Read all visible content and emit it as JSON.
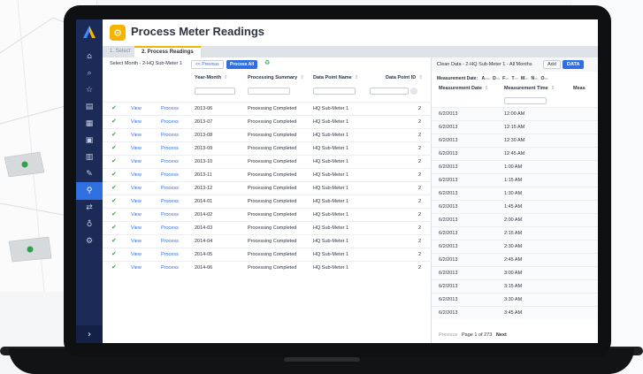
{
  "app": {
    "title": "Process Meter Readings",
    "title_icon": "process-icon"
  },
  "sidebar": {
    "items": [
      {
        "icon": "home-icon",
        "glyph": "⌂"
      },
      {
        "icon": "search-icon",
        "glyph": "⌕"
      },
      {
        "icon": "star-icon",
        "glyph": "☆"
      },
      {
        "icon": "buildings-icon",
        "glyph": "▤"
      },
      {
        "icon": "chart-icon",
        "glyph": "▦"
      },
      {
        "icon": "document-icon",
        "glyph": "▣"
      },
      {
        "icon": "clipboard-icon",
        "glyph": "▥"
      },
      {
        "icon": "wrench-icon",
        "glyph": "✎"
      },
      {
        "icon": "meter-icon",
        "glyph": "⚲"
      },
      {
        "icon": "transfer-icon",
        "glyph": "⇄"
      },
      {
        "icon": "lightbulb-icon",
        "glyph": "♁"
      },
      {
        "icon": "settings-icon",
        "glyph": "⚙"
      }
    ],
    "active_index": 8,
    "expand_glyph": "›"
  },
  "tabs": [
    {
      "label": "1. Select",
      "active": false
    },
    {
      "label": "2. Process Readings",
      "active": true
    }
  ],
  "left_panel": {
    "title": "Select Month - 2-HQ Sub-Meter 1",
    "prev_button": "<< Previous",
    "process_all_button": "Process All",
    "refresh_glyph": "♻",
    "columns": {
      "year_month": "Year-Month",
      "summary": "Processing Summary",
      "dp_name": "Data Point Name",
      "dp_id": "Data Point ID"
    },
    "sort_glyph": "⇕",
    "rows": [
      {
        "check": "✔",
        "view": "View",
        "process": "Process",
        "year_month": "2013-06",
        "summary": "Processing Completed",
        "dp_name": "HQ Sub-Meter 1",
        "dp_id": "2"
      },
      {
        "check": "✔",
        "view": "View",
        "process": "Process",
        "year_month": "2013-07",
        "summary": "Processing Completed",
        "dp_name": "HQ Sub-Meter 1",
        "dp_id": "2"
      },
      {
        "check": "✔",
        "view": "View",
        "process": "Process",
        "year_month": "2013-08",
        "summary": "Processing Completed",
        "dp_name": "HQ Sub-Meter 1",
        "dp_id": "2"
      },
      {
        "check": "✔",
        "view": "View",
        "process": "Process",
        "year_month": "2013-09",
        "summary": "Processing Completed",
        "dp_name": "HQ Sub-Meter 1",
        "dp_id": "2"
      },
      {
        "check": "✔",
        "view": "View",
        "process": "Process",
        "year_month": "2013-10",
        "summary": "Processing Completed",
        "dp_name": "HQ Sub-Meter 1",
        "dp_id": "2"
      },
      {
        "check": "✔",
        "view": "View",
        "process": "Process",
        "year_month": "2013-11",
        "summary": "Processing Completed",
        "dp_name": "HQ Sub-Meter 1",
        "dp_id": "2"
      },
      {
        "check": "✔",
        "view": "View",
        "process": "Process",
        "year_month": "2013-12",
        "summary": "Processing Completed",
        "dp_name": "HQ Sub-Meter 1",
        "dp_id": "2"
      },
      {
        "check": "✔",
        "view": "View",
        "process": "Process",
        "year_month": "2014-01",
        "summary": "Processing Completed",
        "dp_name": "HQ Sub-Meter 1",
        "dp_id": "2"
      },
      {
        "check": "✔",
        "view": "View",
        "process": "Process",
        "year_month": "2014-02",
        "summary": "Processing Completed",
        "dp_name": "HQ Sub-Meter 1",
        "dp_id": "2"
      },
      {
        "check": "✔",
        "view": "View",
        "process": "Process",
        "year_month": "2014-03",
        "summary": "Processing Completed",
        "dp_name": "HQ Sub-Meter 1",
        "dp_id": "2"
      },
      {
        "check": "✔",
        "view": "View",
        "process": "Process",
        "year_month": "2014-04",
        "summary": "Processing Completed",
        "dp_name": "HQ Sub-Meter 1",
        "dp_id": "2"
      },
      {
        "check": "✔",
        "view": "View",
        "process": "Process",
        "year_month": "2014-05",
        "summary": "Processing Completed",
        "dp_name": "HQ Sub-Meter 1",
        "dp_id": "2"
      },
      {
        "check": "✔",
        "view": "View",
        "process": "Process",
        "year_month": "2014-06",
        "summary": "Processing Completed",
        "dp_name": "HQ Sub-Meter 1",
        "dp_id": "2"
      }
    ]
  },
  "right_panel": {
    "title": "Clean Data - 2-HQ Sub-Meter 1 - All Months",
    "add_button": "Add",
    "data_button": "DATA",
    "md_label": "Measurement Date:",
    "md_letters": [
      "A",
      "D",
      "F",
      "T",
      "M",
      "N",
      "O"
    ],
    "md_pcts": [
      "99%",
      "0%",
      "0%",
      "0%",
      "0%",
      "0%",
      "0%"
    ],
    "columns": {
      "date": "Measurement Date",
      "time": "Measurement Time",
      "more": "Meas"
    },
    "sort_glyph": "⇕",
    "rows": [
      {
        "date": "6/2/2013",
        "time": "12:00 AM"
      },
      {
        "date": "6/2/2013",
        "time": "12:15 AM"
      },
      {
        "date": "6/2/2013",
        "time": "12:30 AM"
      },
      {
        "date": "6/2/2013",
        "time": "12:45 AM"
      },
      {
        "date": "6/2/2013",
        "time": "1:00 AM"
      },
      {
        "date": "6/2/2013",
        "time": "1:15 AM"
      },
      {
        "date": "6/2/2013",
        "time": "1:30 AM"
      },
      {
        "date": "6/2/2013",
        "time": "1:45 AM"
      },
      {
        "date": "6/2/2013",
        "time": "2:00 AM"
      },
      {
        "date": "6/2/2013",
        "time": "2:15 AM"
      },
      {
        "date": "6/2/2013",
        "time": "2:30 AM"
      },
      {
        "date": "6/2/2013",
        "time": "2:45 AM"
      },
      {
        "date": "6/2/2013",
        "time": "3:00 AM"
      },
      {
        "date": "6/2/2013",
        "time": "3:15 AM"
      },
      {
        "date": "6/2/2013",
        "time": "3:30 AM"
      },
      {
        "date": "6/2/2013",
        "time": "3:45 AM"
      }
    ],
    "pager": {
      "prev": "Previous",
      "page_info": "Page 1 of 273",
      "next": "Next"
    }
  },
  "colors": {
    "sidebar": "#1c2a57",
    "accent_blue": "#2f6fe0",
    "accent_yellow": "#f4b400",
    "check_green": "#3aa14a"
  }
}
